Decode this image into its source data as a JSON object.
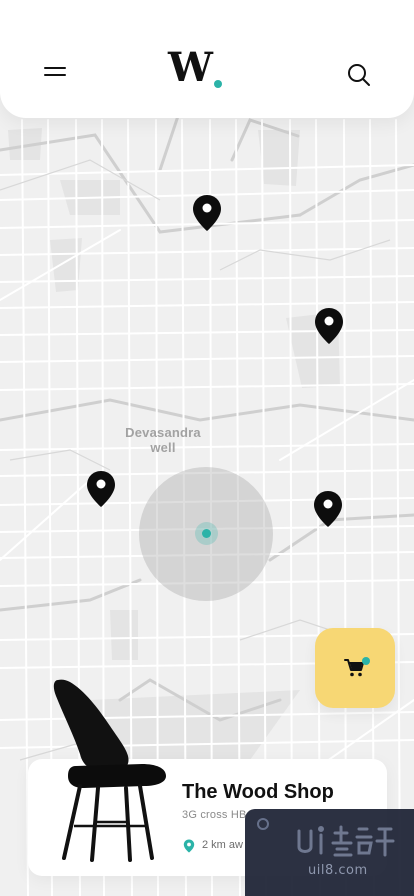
{
  "header": {
    "logo_text": "W",
    "brand_accent": "#2bb3a8",
    "menu_icon": "hamburger-menu-icon",
    "search_icon": "search-icon"
  },
  "map": {
    "place_label_line1": "Devasandra",
    "place_label_line2": "well",
    "store_pin_icon": "map-pin-icon",
    "store_pin_count": 4,
    "current_location_color": "#2bb3a8"
  },
  "cart": {
    "icon": "cart-icon",
    "background": "#f7d774",
    "badge_color": "#2bb3a8"
  },
  "shop": {
    "name": "The Wood Shop",
    "address": "3G cross HB",
    "distance": "2 km aw",
    "image": "black-chair-image"
  },
  "watermark": {
    "logo_text": "ui8",
    "domain": "uil8.com"
  }
}
